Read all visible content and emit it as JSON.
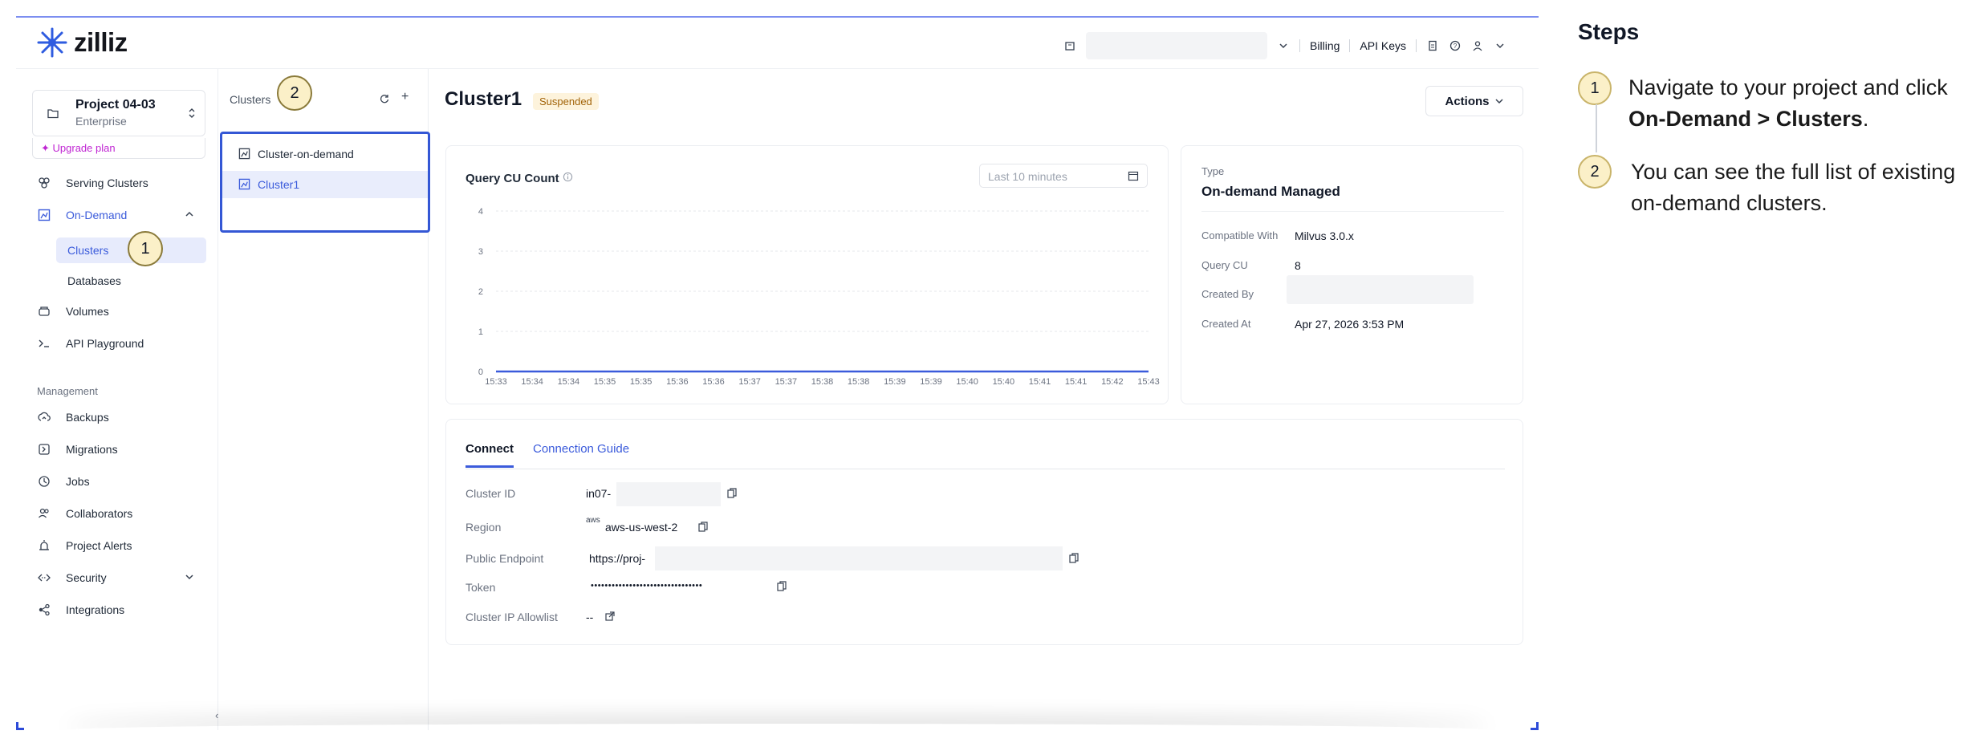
{
  "topbar": {
    "brand": "zilliz",
    "billing": "Billing",
    "api_keys": "API Keys"
  },
  "sidebar": {
    "project_name": "Project 04-03",
    "project_tier": "Enterprise",
    "upgrade": "Upgrade plan",
    "items": [
      {
        "label": "Serving Clusters",
        "icon": "serving-clusters-icon"
      },
      {
        "label": "On-Demand",
        "icon": "on-demand-icon"
      },
      {
        "label": "Volumes",
        "icon": "volume-icon"
      },
      {
        "label": "API Playground",
        "icon": "terminal-icon"
      }
    ],
    "sub_items": [
      "Clusters",
      "Databases"
    ],
    "management_heading": "Management",
    "management_items": [
      {
        "label": "Backups",
        "icon": "backup-icon"
      },
      {
        "label": "Migrations",
        "icon": "migration-icon"
      },
      {
        "label": "Jobs",
        "icon": "jobs-icon"
      },
      {
        "label": "Collaborators",
        "icon": "collaborators-icon"
      },
      {
        "label": "Project Alerts",
        "icon": "alert-icon"
      },
      {
        "label": "Security",
        "icon": "security-icon"
      },
      {
        "label": "Integrations",
        "icon": "integrations-icon"
      }
    ]
  },
  "clusters_panel": {
    "title": "Clusters",
    "items": [
      "Cluster-on-demand",
      "Cluster1"
    ]
  },
  "main": {
    "title": "Cluster1",
    "status": "Suspended",
    "actions": "Actions",
    "chart_title": "Query CU Count",
    "time_range_placeholder": "Last 10 minutes",
    "info": {
      "type_label": "Type",
      "type_value": "On-demand Managed",
      "compat_label": "Compatible With",
      "compat_value": "Milvus 3.0.x",
      "query_cu_label": "Query CU",
      "query_cu_value": "8",
      "created_by_label": "Created By",
      "created_at_label": "Created At",
      "created_at_value": "Apr 27, 2026 3:53 PM"
    },
    "connect": {
      "tab_connect": "Connect",
      "tab_guide": "Connection Guide",
      "cluster_id_label": "Cluster ID",
      "cluster_id_value": "in07-",
      "region_label": "Region",
      "region_badge": "aws",
      "region_value": "aws-us-west-2",
      "endpoint_label": "Public Endpoint",
      "endpoint_value": "https://proj-",
      "token_label": "Token",
      "token_value": "••••••••••••••••••••••••••••••••",
      "allowlist_label": "Cluster IP Allowlist",
      "allowlist_value": "--"
    }
  },
  "chart_data": {
    "type": "line",
    "title": "Query CU Count",
    "x": [
      "15:33",
      "15:34",
      "15:34",
      "15:35",
      "15:35",
      "15:36",
      "15:36",
      "15:37",
      "15:37",
      "15:38",
      "15:38",
      "15:39",
      "15:39",
      "15:40",
      "15:40",
      "15:41",
      "15:41",
      "15:42",
      "15:43"
    ],
    "series": [
      {
        "values": [
          0,
          0,
          0,
          0,
          0,
          0,
          0,
          0,
          0,
          0,
          0,
          0,
          0,
          0,
          0,
          0,
          0,
          0,
          0
        ]
      }
    ],
    "y_ticks": [
      0,
      1,
      2,
      3,
      4
    ],
    "ylim": [
      0,
      4
    ],
    "grid": true,
    "line_color": "#3b5bdb"
  },
  "annotations": {
    "badge1": "1",
    "badge2": "2"
  },
  "steps": {
    "title": "Steps",
    "items": [
      {
        "num": "1",
        "text_before": "Navigate to your project and click ",
        "bold": "On-Demand > Clusters",
        "text_after": "."
      },
      {
        "num": "2",
        "text": "You can see the full list of existing on-demand clusters."
      }
    ]
  }
}
